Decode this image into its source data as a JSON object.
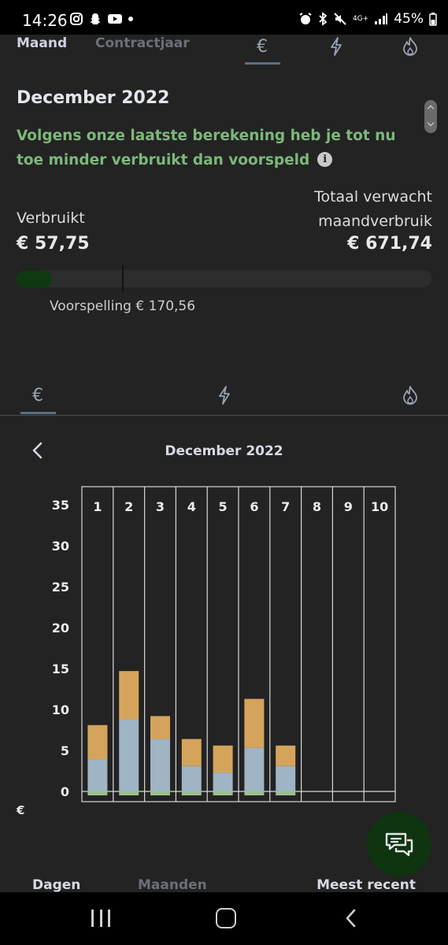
{
  "status_bar": {
    "time": "14:26",
    "battery": "45%",
    "network": "4G+"
  },
  "top_tabs": {
    "maand": "Maand",
    "contractjaar": "Contractjaar",
    "euro_symbol": "€",
    "active_tab": "euro-icon"
  },
  "summary": {
    "month": "December 2022",
    "message": "Volgens onze laatste berekening heb je tot nu toe minder verbruikt dan voorspeld",
    "verbruikt_label": "Verbruikt",
    "verbruikt_value": "€ 57,75",
    "totaal_label": "Totaal verwacht maandverbruik",
    "totaal_value": "€ 671,74",
    "progress_fraction": 0.086,
    "forecast_marker_fraction": 0.254,
    "voorspelling": "Voorspelling € 170,56",
    "accent_green": "#7db87a"
  },
  "mid_tabs": {
    "euro_symbol": "€",
    "active_tab": "euro-icon"
  },
  "chart_header": {
    "title": "December 2022"
  },
  "chart_data": {
    "type": "bar",
    "stacked": true,
    "categories": [
      "1",
      "2",
      "3",
      "4",
      "5",
      "6",
      "7",
      "8",
      "9",
      "10"
    ],
    "series": [
      {
        "color": "#9fb4c4",
        "values": [
          3.9,
          8.8,
          6.4,
          3.1,
          2.3,
          5.3,
          3.1,
          null,
          null,
          null
        ]
      },
      {
        "color": "#d5a45c",
        "values": [
          4.2,
          5.9,
          2.8,
          3.3,
          3.3,
          6.0,
          2.5,
          null,
          null,
          null
        ]
      }
    ],
    "ylim": [
      0,
      35
    ],
    "yticks": [
      35,
      30,
      25,
      20,
      15,
      10,
      5,
      0
    ],
    "ylabel": "€",
    "grid": "vertical"
  },
  "bottom_controls": {
    "dagen": "Dagen",
    "maanden": "Maanden",
    "meest_recent": "Meest recent"
  }
}
